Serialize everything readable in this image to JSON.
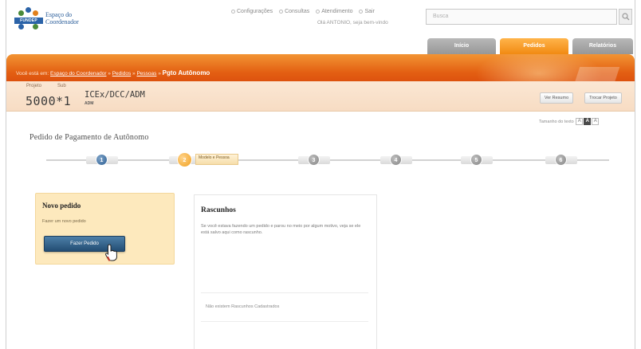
{
  "header": {
    "logo_word": "FUNDEP",
    "logo_line1": "Espaço do",
    "logo_line2": "Coordenador",
    "top_links": [
      "Configurações",
      "Consultas",
      "Atendimento",
      "Sair"
    ],
    "user_line": "Olá ANTONIO, seja bem-vindo",
    "search_placeholder": "Busca"
  },
  "tabs": [
    {
      "label": "Início",
      "active": false
    },
    {
      "label": "Pedidos",
      "active": true
    },
    {
      "label": "Relatórios",
      "active": false
    }
  ],
  "breadcrumb": {
    "prefix": "Você está em:",
    "items": [
      "Espaço do Coordenador",
      "Pedidos",
      "Pessoas"
    ],
    "current": "Pgto Autônomo"
  },
  "project": {
    "label_project": "Projeto",
    "label_sub": "Sub",
    "number": "5000*1",
    "unit": "ICEx/DCC/ADM",
    "unit_sub": "ADM",
    "btn_summary": "Ver Resumo",
    "btn_change": "Trocar Projeto"
  },
  "font_size": {
    "label": "Tamanho do texto",
    "options": [
      "A",
      "A",
      "A"
    ]
  },
  "page": {
    "title": "Pedido de Pagamento de Autônomo"
  },
  "steps": {
    "numbers": [
      "1",
      "2",
      "3",
      "4",
      "5",
      "6"
    ],
    "current_label": "Modelo e Pessoa"
  },
  "new_order": {
    "title": "Novo pedido",
    "text": "Fazer um novo pedido",
    "button": "Fazer Pedido"
  },
  "drafts": {
    "title": "Rascunhos",
    "text": "Se você estava fazendo um pedido e parou no meio por algum motivo, veja se ele está salvo aqui como rascunho.",
    "empty": "Não existem Rascunhos Cadastrados"
  },
  "colors": {
    "accent_orange": "#e35f12",
    "nav_blue": "#234d73"
  }
}
